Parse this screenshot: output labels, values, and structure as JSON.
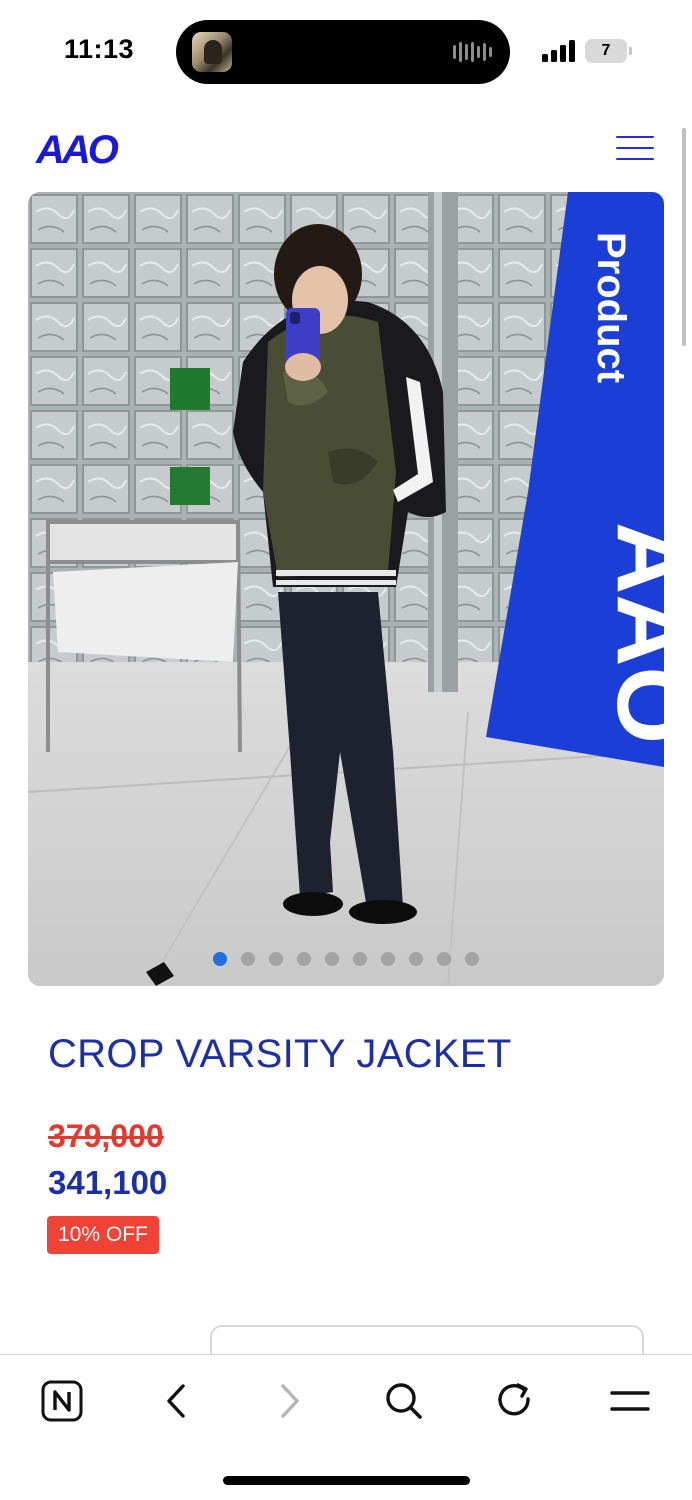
{
  "status_bar": {
    "time": "11:13",
    "battery": "7",
    "icons": [
      "now-playing-thumbnail",
      "audio-waveform-icon",
      "cellular-signal-icon",
      "battery-icon"
    ]
  },
  "site": {
    "logo": "AAO",
    "menu_icon": "hamburger-menu-icon",
    "brand_color": "#1a1ad6"
  },
  "product": {
    "title": "CROP VARSITY JACKET",
    "original_price": "379,000",
    "sale_price": "341,100",
    "discount_badge": "10% OFF",
    "banner_text": "AAO",
    "banner_subtext": "Product"
  },
  "gallery": {
    "image_count": 10,
    "active_index": 0
  },
  "browser_toolbar": {
    "buttons": [
      "naver-home-icon",
      "back-icon",
      "forward-icon",
      "search-icon",
      "refresh-icon",
      "menu-icon"
    ]
  },
  "colors": {
    "accent": "#1c2fa8",
    "price_strike": "#e5392e",
    "badge_bg": "#f14236",
    "dot_active": "#1f6fe0"
  }
}
